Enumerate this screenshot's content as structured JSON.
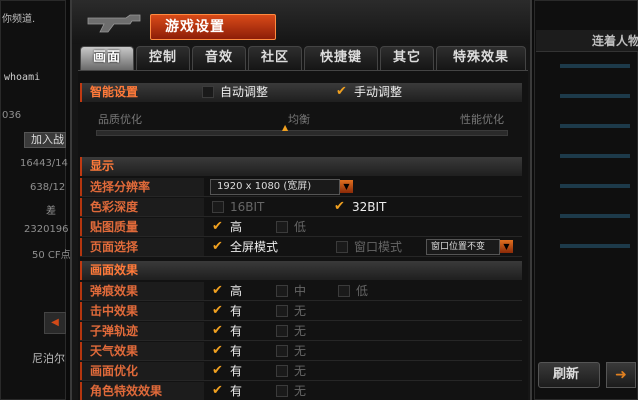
{
  "bg": {
    "left": {
      "channel": "你频道.",
      "user": "whoami",
      "num": "036",
      "btn": "加入战",
      "stat1": "16443/14",
      "stat2": "638/12",
      "stat3": "差",
      "stat4": "2320196",
      "stat5": "50 CF点",
      "name": "尼泊尔"
    },
    "right": {
      "top": "连着人物",
      "refresh": "刷新"
    }
  },
  "window": {
    "title": "游戏设置"
  },
  "tabs": [
    "画面",
    "控制",
    "音效",
    "社区",
    "快捷键",
    "其它",
    "特殊效果"
  ],
  "settings": {
    "section_label": "智能设置",
    "auto_label": "自动调整",
    "manual_label": "手动调整",
    "quality_left": "品质优化",
    "quality_mid": "均衡",
    "quality_right": "性能优化"
  },
  "display": {
    "section_title": "显示",
    "resolution_label": "选择分辨率",
    "resolution_value": "1920 x 1080 (宽屏)",
    "color_label": "色彩深度",
    "color_opt1": "16BIT",
    "color_opt2": "32BIT",
    "texture_label": "贴图质量",
    "texture_opt1": "高",
    "texture_opt2": "低",
    "window_label": "页面选择",
    "window_opt1": "全屏模式",
    "window_opt2": "窗口模式",
    "window_pos": "窗口位置不变"
  },
  "effects": {
    "section_title": "画面效果",
    "rows": [
      {
        "label": "弹痕效果",
        "a": "高",
        "b": "中",
        "c": "低"
      },
      {
        "label": "击中效果",
        "a": "有",
        "b": "无"
      },
      {
        "label": "子弹轨迹",
        "a": "有",
        "b": "无"
      },
      {
        "label": "天气效果",
        "a": "有",
        "b": "无"
      },
      {
        "label": "画面优化",
        "a": "有",
        "b": "无"
      },
      {
        "label": "角色特效效果",
        "a": "有",
        "b": "无"
      }
    ]
  },
  "colors": {
    "accent": "#f0a020",
    "label": "#e06a3a",
    "title": "#d94b18"
  }
}
